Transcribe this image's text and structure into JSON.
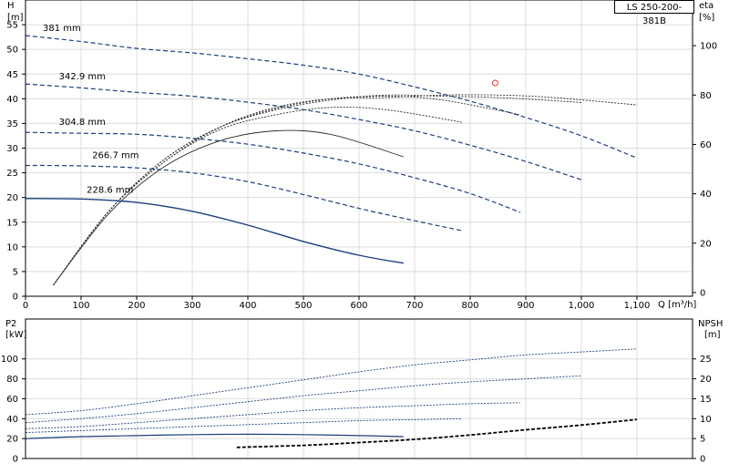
{
  "model": "LS 250-200-381B",
  "chart_data": [
    {
      "type": "line",
      "title": "",
      "xlabel": "Q [m³/h]",
      "xlim": [
        0,
        1200
      ],
      "x_ticks": [
        "0",
        "100",
        "200",
        "300",
        "400",
        "500",
        "600",
        "700",
        "800",
        "900",
        "1,000",
        "1,100"
      ],
      "ylabel_left": [
        "H",
        "[m]"
      ],
      "ylim_left": [
        0,
        60
      ],
      "y_ticks_left": [
        "0",
        "5",
        "10",
        "15",
        "20",
        "25",
        "30",
        "35",
        "40",
        "45",
        "50",
        "55"
      ],
      "ylabel_right": [
        "eta",
        "[%]"
      ],
      "ylim_right": [
        -1.5,
        118.5
      ],
      "y_ticks_right": [
        "0",
        "20",
        "40",
        "60",
        "80",
        "100"
      ],
      "grid": true,
      "head_series": [
        {
          "name": "381 mm",
          "label_at": [
            300,
            53.2
          ],
          "x": [
            0,
            100,
            200,
            300,
            400,
            500,
            600,
            700,
            800,
            900,
            1000,
            1100
          ],
          "y": [
            52.8,
            51.6,
            50.2,
            49.3,
            48.1,
            46.8,
            45.0,
            42.4,
            39.5,
            36.2,
            32.5,
            28.0
          ]
        },
        {
          "name": "342.9 mm",
          "label_at": [
            60,
            43.4
          ],
          "x": [
            0,
            100,
            200,
            300,
            400,
            500,
            600,
            700,
            800,
            900,
            1000
          ],
          "y": [
            43.0,
            42.2,
            41.3,
            40.5,
            39.3,
            37.8,
            35.8,
            33.5,
            30.6,
            27.3,
            23.6
          ]
        },
        {
          "name": "304.8 mm",
          "label_at": [
            60,
            34.2
          ],
          "x": [
            0,
            100,
            200,
            300,
            400,
            500,
            600,
            700,
            800,
            890
          ],
          "y": [
            33.2,
            33.0,
            32.8,
            32.0,
            30.8,
            29.0,
            26.8,
            24.0,
            20.8,
            17.0
          ]
        },
        {
          "name": "266.7 mm",
          "label_at": [
            120,
            27.4
          ],
          "x": [
            0,
            100,
            200,
            300,
            400,
            500,
            600,
            700,
            785
          ],
          "y": [
            26.5,
            26.4,
            26.0,
            25.0,
            23.2,
            20.6,
            17.8,
            15.3,
            13.3
          ]
        },
        {
          "name": "228.6 mm",
          "label_at": [
            110,
            20.4
          ],
          "x": [
            0,
            100,
            200,
            300,
            400,
            500,
            600,
            680
          ],
          "y": [
            19.8,
            19.7,
            19.0,
            17.2,
            14.4,
            11.1,
            8.3,
            6.7
          ]
        }
      ],
      "efficiency_series": [
        {
          "x": [
            50,
            150,
            250,
            350,
            450,
            550,
            650,
            750,
            850,
            950,
            1100
          ],
          "y": [
            3,
            33,
            53,
            67,
            75,
            78.5,
            79,
            80,
            80,
            79,
            76
          ]
        },
        {
          "x": [
            50,
            150,
            250,
            350,
            450,
            550,
            650,
            750,
            850,
            1000
          ],
          "y": [
            3,
            33,
            54,
            67,
            74,
            78,
            80,
            79.5,
            79,
            77
          ]
        },
        {
          "x": [
            50,
            150,
            250,
            350,
            450,
            550,
            650,
            750,
            890
          ],
          "y": [
            3,
            33,
            54,
            67,
            74.5,
            78.5,
            79.5,
            78,
            72
          ]
        },
        {
          "x": [
            50,
            150,
            250,
            350,
            450,
            550,
            650,
            785
          ],
          "y": [
            3,
            33,
            53,
            66,
            72,
            75,
            74,
            69
          ]
        },
        {
          "x": [
            50,
            150,
            250,
            350,
            450,
            550,
            680
          ],
          "y": [
            3,
            32,
            51,
            61.5,
            65.5,
            64,
            55
          ]
        }
      ],
      "marker": {
        "x": 845,
        "y": 43.2,
        "color": "#e53935"
      }
    },
    {
      "type": "line",
      "title": "",
      "xlim": [
        0,
        1200
      ],
      "ylabel_left": [
        "P2",
        "[kW]"
      ],
      "ylim_left": [
        0,
        140
      ],
      "y_ticks_left": [
        "0",
        "20",
        "40",
        "60",
        "80",
        "100"
      ],
      "ylabel_right": [
        "NPSH",
        "[m]"
      ],
      "ylim_right": [
        0,
        35
      ],
      "y_ticks_right": [
        "0",
        "5",
        "10",
        "15",
        "20",
        "25"
      ],
      "grid": true,
      "power_series": [
        {
          "x": [
            0,
            100,
            200,
            300,
            400,
            500,
            600,
            700,
            800,
            900,
            1000,
            1100
          ],
          "y": [
            44,
            48,
            55,
            63,
            71,
            79,
            87,
            94,
            99,
            104,
            107,
            110
          ]
        },
        {
          "x": [
            0,
            100,
            200,
            300,
            400,
            500,
            600,
            700,
            800,
            900,
            1000
          ],
          "y": [
            36,
            40,
            45,
            51,
            57,
            63,
            68,
            73,
            77,
            80,
            83
          ]
        },
        {
          "x": [
            0,
            100,
            200,
            300,
            400,
            500,
            600,
            700,
            800,
            890
          ],
          "y": [
            30,
            32,
            36,
            40,
            44,
            48,
            51,
            53,
            55,
            56
          ]
        },
        {
          "x": [
            0,
            100,
            200,
            300,
            400,
            500,
            600,
            700,
            785
          ],
          "y": [
            26,
            28,
            30,
            32,
            34,
            36,
            38,
            39,
            40
          ]
        },
        {
          "x": [
            0,
            100,
            200,
            300,
            400,
            500,
            600,
            680
          ],
          "y": [
            20,
            22,
            23,
            24,
            24.3,
            24,
            23,
            22
          ]
        }
      ],
      "npsh": {
        "x": [
          380,
          500,
          600,
          700,
          800,
          900,
          1000,
          1100
        ],
        "y": [
          2.8,
          3.3,
          4.0,
          4.8,
          5.9,
          7.2,
          8.4,
          9.8
        ]
      }
    }
  ],
  "colors": {
    "head": "#1d3f7a",
    "efficiency": "#2b2b2b",
    "power": "#1d3f7a",
    "npsh": "#000000",
    "grid": "#dcdcdc"
  }
}
